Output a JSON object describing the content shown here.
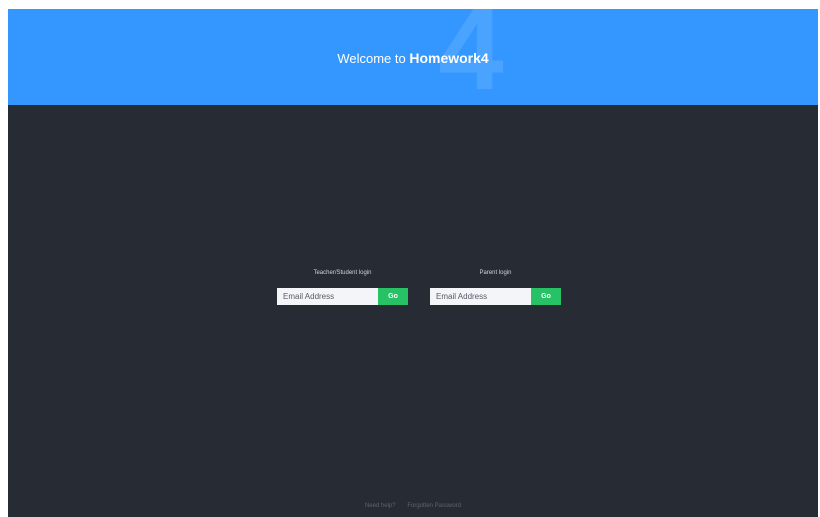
{
  "header": {
    "welcome_prefix": "Welcome to ",
    "brand_name": "Homework4",
    "background_digit": "4"
  },
  "login": {
    "teacher": {
      "label": "Teacher/Student login",
      "email_placeholder": "Email Address",
      "button_label": "Go"
    },
    "parent": {
      "label": "Parent login",
      "email_placeholder": "Email Address",
      "button_label": "Go"
    }
  },
  "footer": {
    "help_link": "Need help?",
    "forgot_link": "Forgotten Password"
  },
  "colors": {
    "header_blue": "#3397ff",
    "body_dark": "#262b34",
    "go_green": "#27c265"
  }
}
